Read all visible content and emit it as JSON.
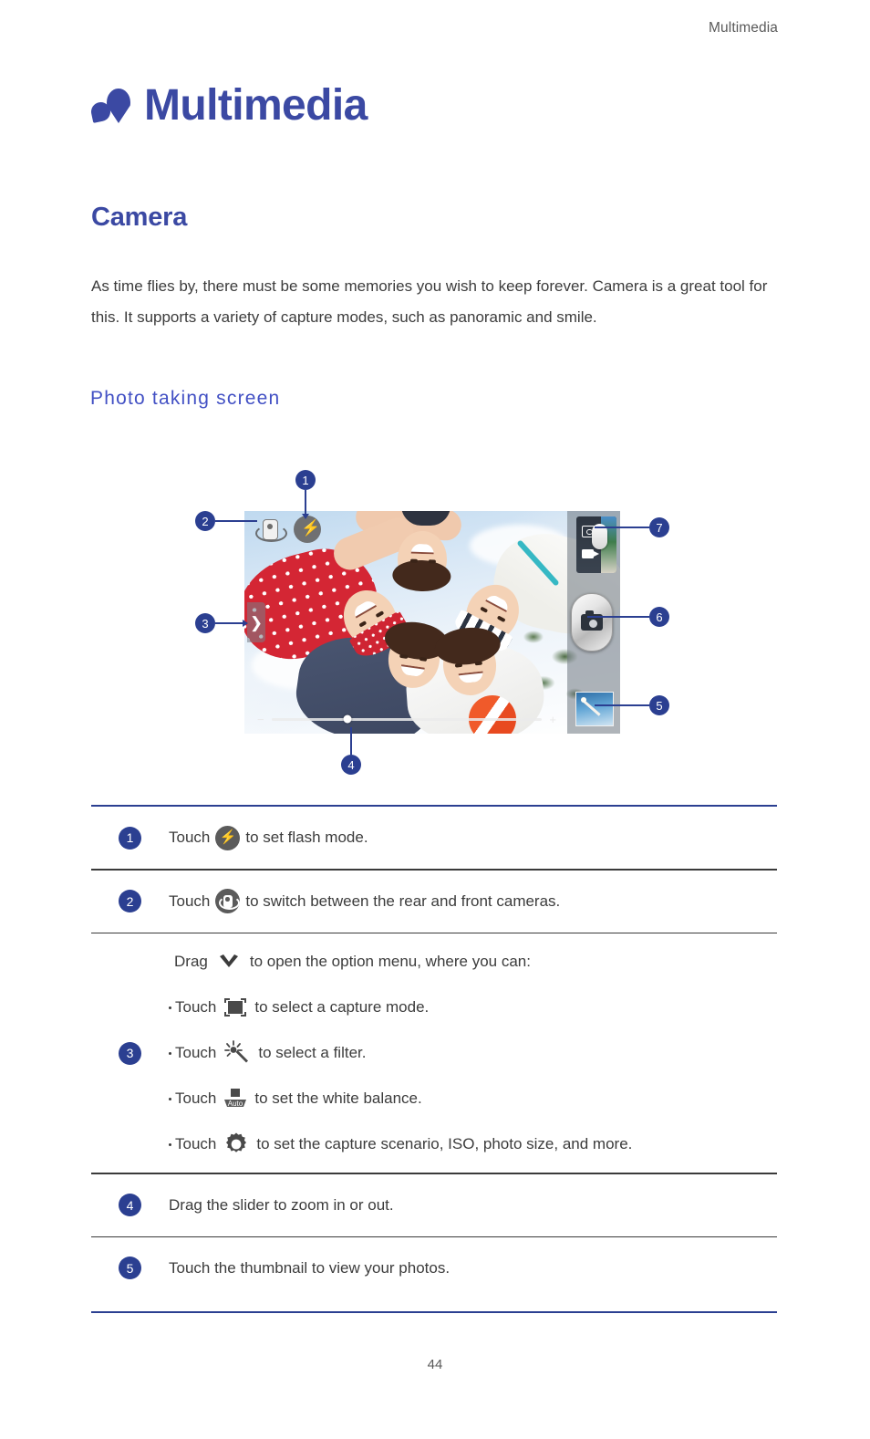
{
  "header": {
    "running_title": "Multimedia"
  },
  "chapter": {
    "title": "Multimedia",
    "mark_icon": "petal-mark-icon"
  },
  "section": {
    "title": "Camera",
    "intro": "As time flies by, there must be some memories you wish to keep forever. Camera is a great tool for this. It supports a variety of capture modes, such as panoramic and smile.",
    "subheading": "Photo taking screen"
  },
  "figure": {
    "callouts": [
      {
        "number": "1",
        "target": "flash-button"
      },
      {
        "number": "2",
        "target": "camera-switch-button"
      },
      {
        "number": "3",
        "target": "option-menu-handle"
      },
      {
        "number": "4",
        "target": "zoom-slider"
      },
      {
        "number": "5",
        "target": "gallery-thumbnail"
      },
      {
        "number": "6",
        "target": "shutter-button"
      },
      {
        "number": "7",
        "target": "photo-video-toggle"
      }
    ],
    "zoom_slider": {
      "minus_label": "−",
      "plus_label": "+",
      "handle_position_percent": 28
    }
  },
  "legend": {
    "rows": [
      {
        "number": "1",
        "icon": "flash-icon",
        "text_before": "Touch",
        "text_after": "to set flash mode."
      },
      {
        "number": "2",
        "icon": "camera-switch-icon",
        "text_before": "Touch",
        "text_after": "to switch between the rear and front cameras."
      },
      {
        "number": "3",
        "intro_before": "Drag",
        "intro_icon": "chevron-down-icon",
        "intro_after": "to open the option menu, where you can:",
        "bullets": [
          {
            "text_before": "Touch",
            "icon": "capture-mode-icon",
            "text_after": "to select a capture mode."
          },
          {
            "text_before": "Touch",
            "icon": "filter-icon",
            "text_after": "to select a filter."
          },
          {
            "text_before": "Touch",
            "icon": "white-balance-auto-icon",
            "text_after": "to set the white balance."
          },
          {
            "text_before": "Touch",
            "icon": "settings-gear-icon",
            "text_after": "to set the capture scenario, ISO, photo size, and more."
          }
        ]
      },
      {
        "number": "4",
        "text": "Drag the slider to zoom in or out."
      },
      {
        "number": "5",
        "text": "Touch the thumbnail to view your photos."
      }
    ]
  },
  "footer": {
    "page_number": "44"
  },
  "colors": {
    "heading_blue": "#3b49a3",
    "subheading_blue": "#4250c4",
    "rule_blue": "#2b3f91",
    "body_gray": "#3c3c3c"
  }
}
